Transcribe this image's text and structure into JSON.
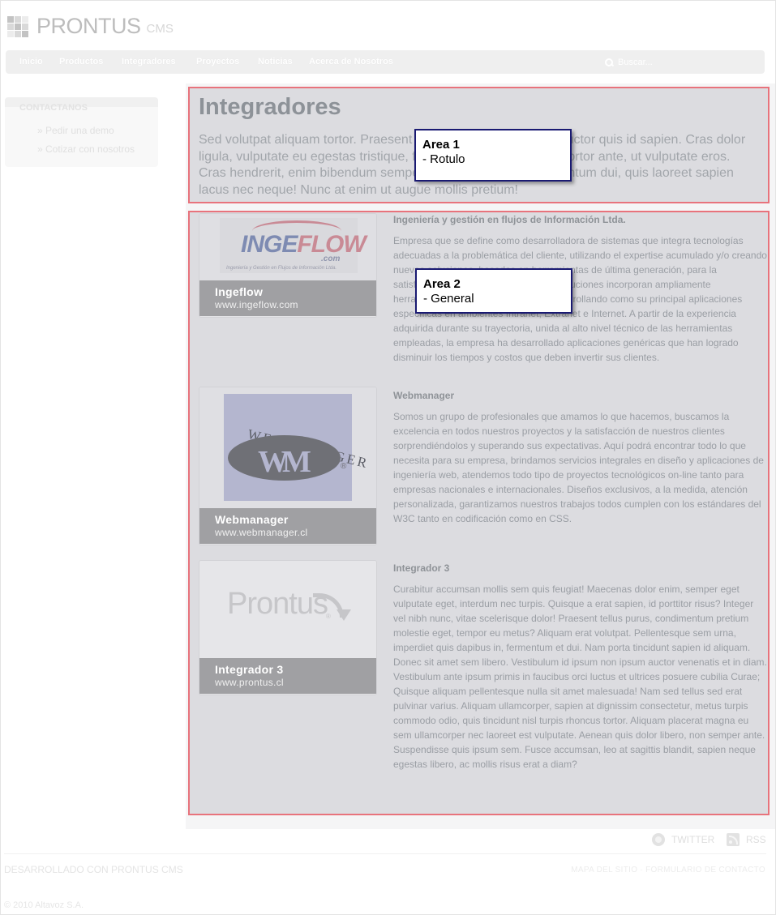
{
  "header": {
    "logo_text": "PRONTUS",
    "logo_sub": "CMS"
  },
  "nav": {
    "items": [
      "Inicio",
      "Productos",
      "Integradores",
      "Proyectos",
      "Noticias",
      "Acerca de Nosotros"
    ],
    "search_placeholder": "Buscar..."
  },
  "sidebar": {
    "title": "CONTACTANOS",
    "links": [
      "» Pedir una demo",
      "» Cotizar con nosotros"
    ]
  },
  "main": {
    "title": "Integradores",
    "intro": "Sed volutpat aliquam tortor. Praesent a purus quis mi tincidunt auctor quis id sapien. Cras dolor ligula, vulputate eu egestas tristique, fermentum vel lorem. Sed tortor ante, ut vulputate eros. Cras hendrerit, enim bibendum semper fringilla, lacus nisi elementum dui, quis laoreet sapien lacus nec neque! Nunc at enim ut augue mollis pretium!",
    "items": [
      {
        "name": "Ingeflow",
        "url": "www.ingeflow.com",
        "logo_word_1": "INGE",
        "logo_word_2": "FLOW",
        "logo_com": ".com",
        "logo_tag": "Ingeniería y Gestión en Flujos de Información Ltda.",
        "title": "Ingeniería y gestión en flujos de Información Ltda.",
        "text": "Empresa que se define como desarrolladora de sistemas que integra tecnologías adecuadas a la problemática del cliente, utilizando el expertise acumulado y/o creando nuevas soluciones, basadas en herramientas de última generación, para la satisfacción de sus necesidades. Sus soluciones incorporan ampliamente herramientas de última generación, desarrollando como su principal aplicaciones específicas en ambientes Intranet, Extranet e Internet. A partir de la experiencia adquirida durante su trayectoria, unida al alto nivel técnico de las herramientas empleadas, la empresa ha desarrollado aplicaciones genéricas que han logrado disminuir los tiempos y costos que deben invertir sus clientes."
      },
      {
        "name": "Webmanager",
        "url": "www.webmanager.cl",
        "logo_word": "WEBMANAGER",
        "logo_mark": "WM",
        "logo_registered": "®",
        "title": "Webmanager",
        "text": "Somos un grupo de profesionales que amamos lo que hacemos, buscamos la excelencia en todos nuestros proyectos y la satisfacción de nuestros clientes sorprendiéndolos y superando sus expectativas. Aquí podrá encontrar todo lo que necesita para su empresa, brindamos servicios integrales en diseño y aplicaciones de ingeniería web, atendemos todo tipo de proyectos tecnológicos on-line tanto para empresas nacionales e internacionales. Diseños exclusivos, a la medida, atención personalizada, garantizamos nuestros trabajos todos cumplen con los estándares del W3C tanto en codificación como en CSS."
      },
      {
        "name": "Integrador 3",
        "url": "www.prontus.cl",
        "logo_word": "Prontus",
        "logo_registered": "®",
        "title": "Integrador 3",
        "text": "Curabitur accumsan mollis sem quis feugiat! Maecenas dolor enim, semper eget vulputate eget, interdum nec turpis. Quisque a erat sapien, id porttitor risus? Integer vel nibh nunc, vitae scelerisque dolor! Praesent tellus purus, condimentum pretium molestie eget, tempor eu metus? Aliquam erat volutpat. Pellentesque sem urna, imperdiet quis dapibus in, fermentum et dui. Nam porta tincidunt sapien id aliquam. Donec sit amet sem libero. Vestibulum id ipsum non ipsum auctor venenatis et in diam. Vestibulum ante ipsum primis in faucibus orci luctus et ultrices posuere cubilia Curae; Quisque aliquam pellentesque nulla sit amet malesuada! Nam sed tellus sed erat pulvinar varius. Aliquam ullamcorper, sapien at dignissim consectetur, metus turpis commodo odio, quis tincidunt nisl turpis rhoncus tortor. Aliquam placerat magna eu sem ullamcorper nec laoreet est vulputate. Aenean quis dolor libero, non semper ante. Suspendisse quis ipsum sem. Fusce accumsan, leo at sagittis blandit, sapien neque egestas libero, ac mollis risus erat a diam?"
      }
    ]
  },
  "annotations": {
    "area1": {
      "title": "Area 1",
      "subtitle": "- Rotulo"
    },
    "area2": {
      "title": "Area 2",
      "subtitle": "- General"
    }
  },
  "footer": {
    "twitter": "TWITTER",
    "rss": "RSS",
    "developed_by": "DESARROLLADO CON PRONTUS CMS",
    "links": "MAPA DEL SITIO · FORMULARIO DE CONTACTO",
    "copyright": "© 2010 Altavoz S.A."
  },
  "colors": {
    "highlight_border": "#e8737c",
    "highlight_fill": "#dcdce0",
    "label_border": "#1a1a72"
  }
}
